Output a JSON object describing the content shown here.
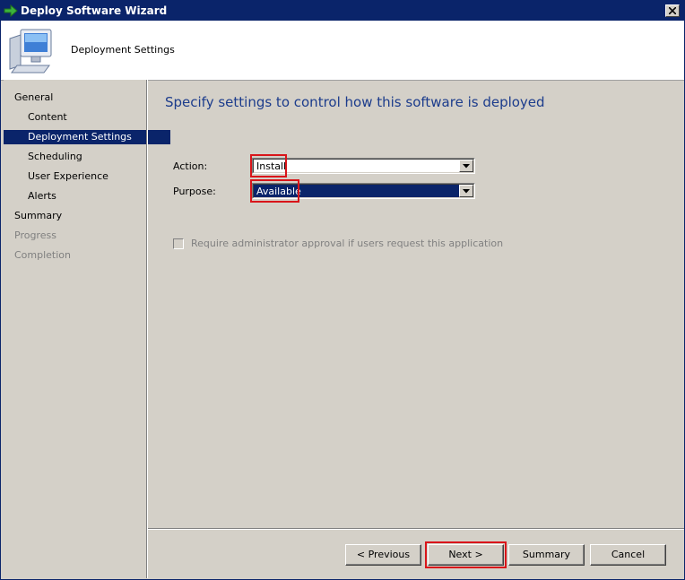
{
  "window": {
    "title": "Deploy Software Wizard",
    "icon": "green-arrow-icon",
    "close_icon": "close-icon"
  },
  "header": {
    "icon": "computer-icon",
    "title": "Deployment Settings"
  },
  "nav": {
    "items": [
      {
        "label": "General",
        "level": 0,
        "state": "normal"
      },
      {
        "label": "Content",
        "level": 1,
        "state": "normal"
      },
      {
        "label": "Deployment Settings",
        "level": 1,
        "state": "selected"
      },
      {
        "label": "Scheduling",
        "level": 1,
        "state": "normal"
      },
      {
        "label": "User Experience",
        "level": 1,
        "state": "normal"
      },
      {
        "label": "Alerts",
        "level": 1,
        "state": "normal"
      },
      {
        "label": "Summary",
        "level": 0,
        "state": "normal"
      },
      {
        "label": "Progress",
        "level": 0,
        "state": "disabled"
      },
      {
        "label": "Completion",
        "level": 0,
        "state": "disabled"
      }
    ]
  },
  "main": {
    "heading": "Specify settings to control how this software is deployed",
    "action": {
      "label": "Action:",
      "value": "Install"
    },
    "purpose": {
      "label": "Purpose:",
      "value": "Available"
    },
    "approval_checkbox": {
      "label": "Require administrator approval if users request this application",
      "checked": false,
      "enabled": false
    }
  },
  "buttons": {
    "previous": "< Previous",
    "next": "Next >",
    "summary": "Summary",
    "cancel": "Cancel"
  },
  "colors": {
    "title_bar": "#0a246a",
    "selection": "#0a246a",
    "heading": "#1c3c8c",
    "highlight": "#d9151a",
    "face": "#d4d0c8"
  }
}
